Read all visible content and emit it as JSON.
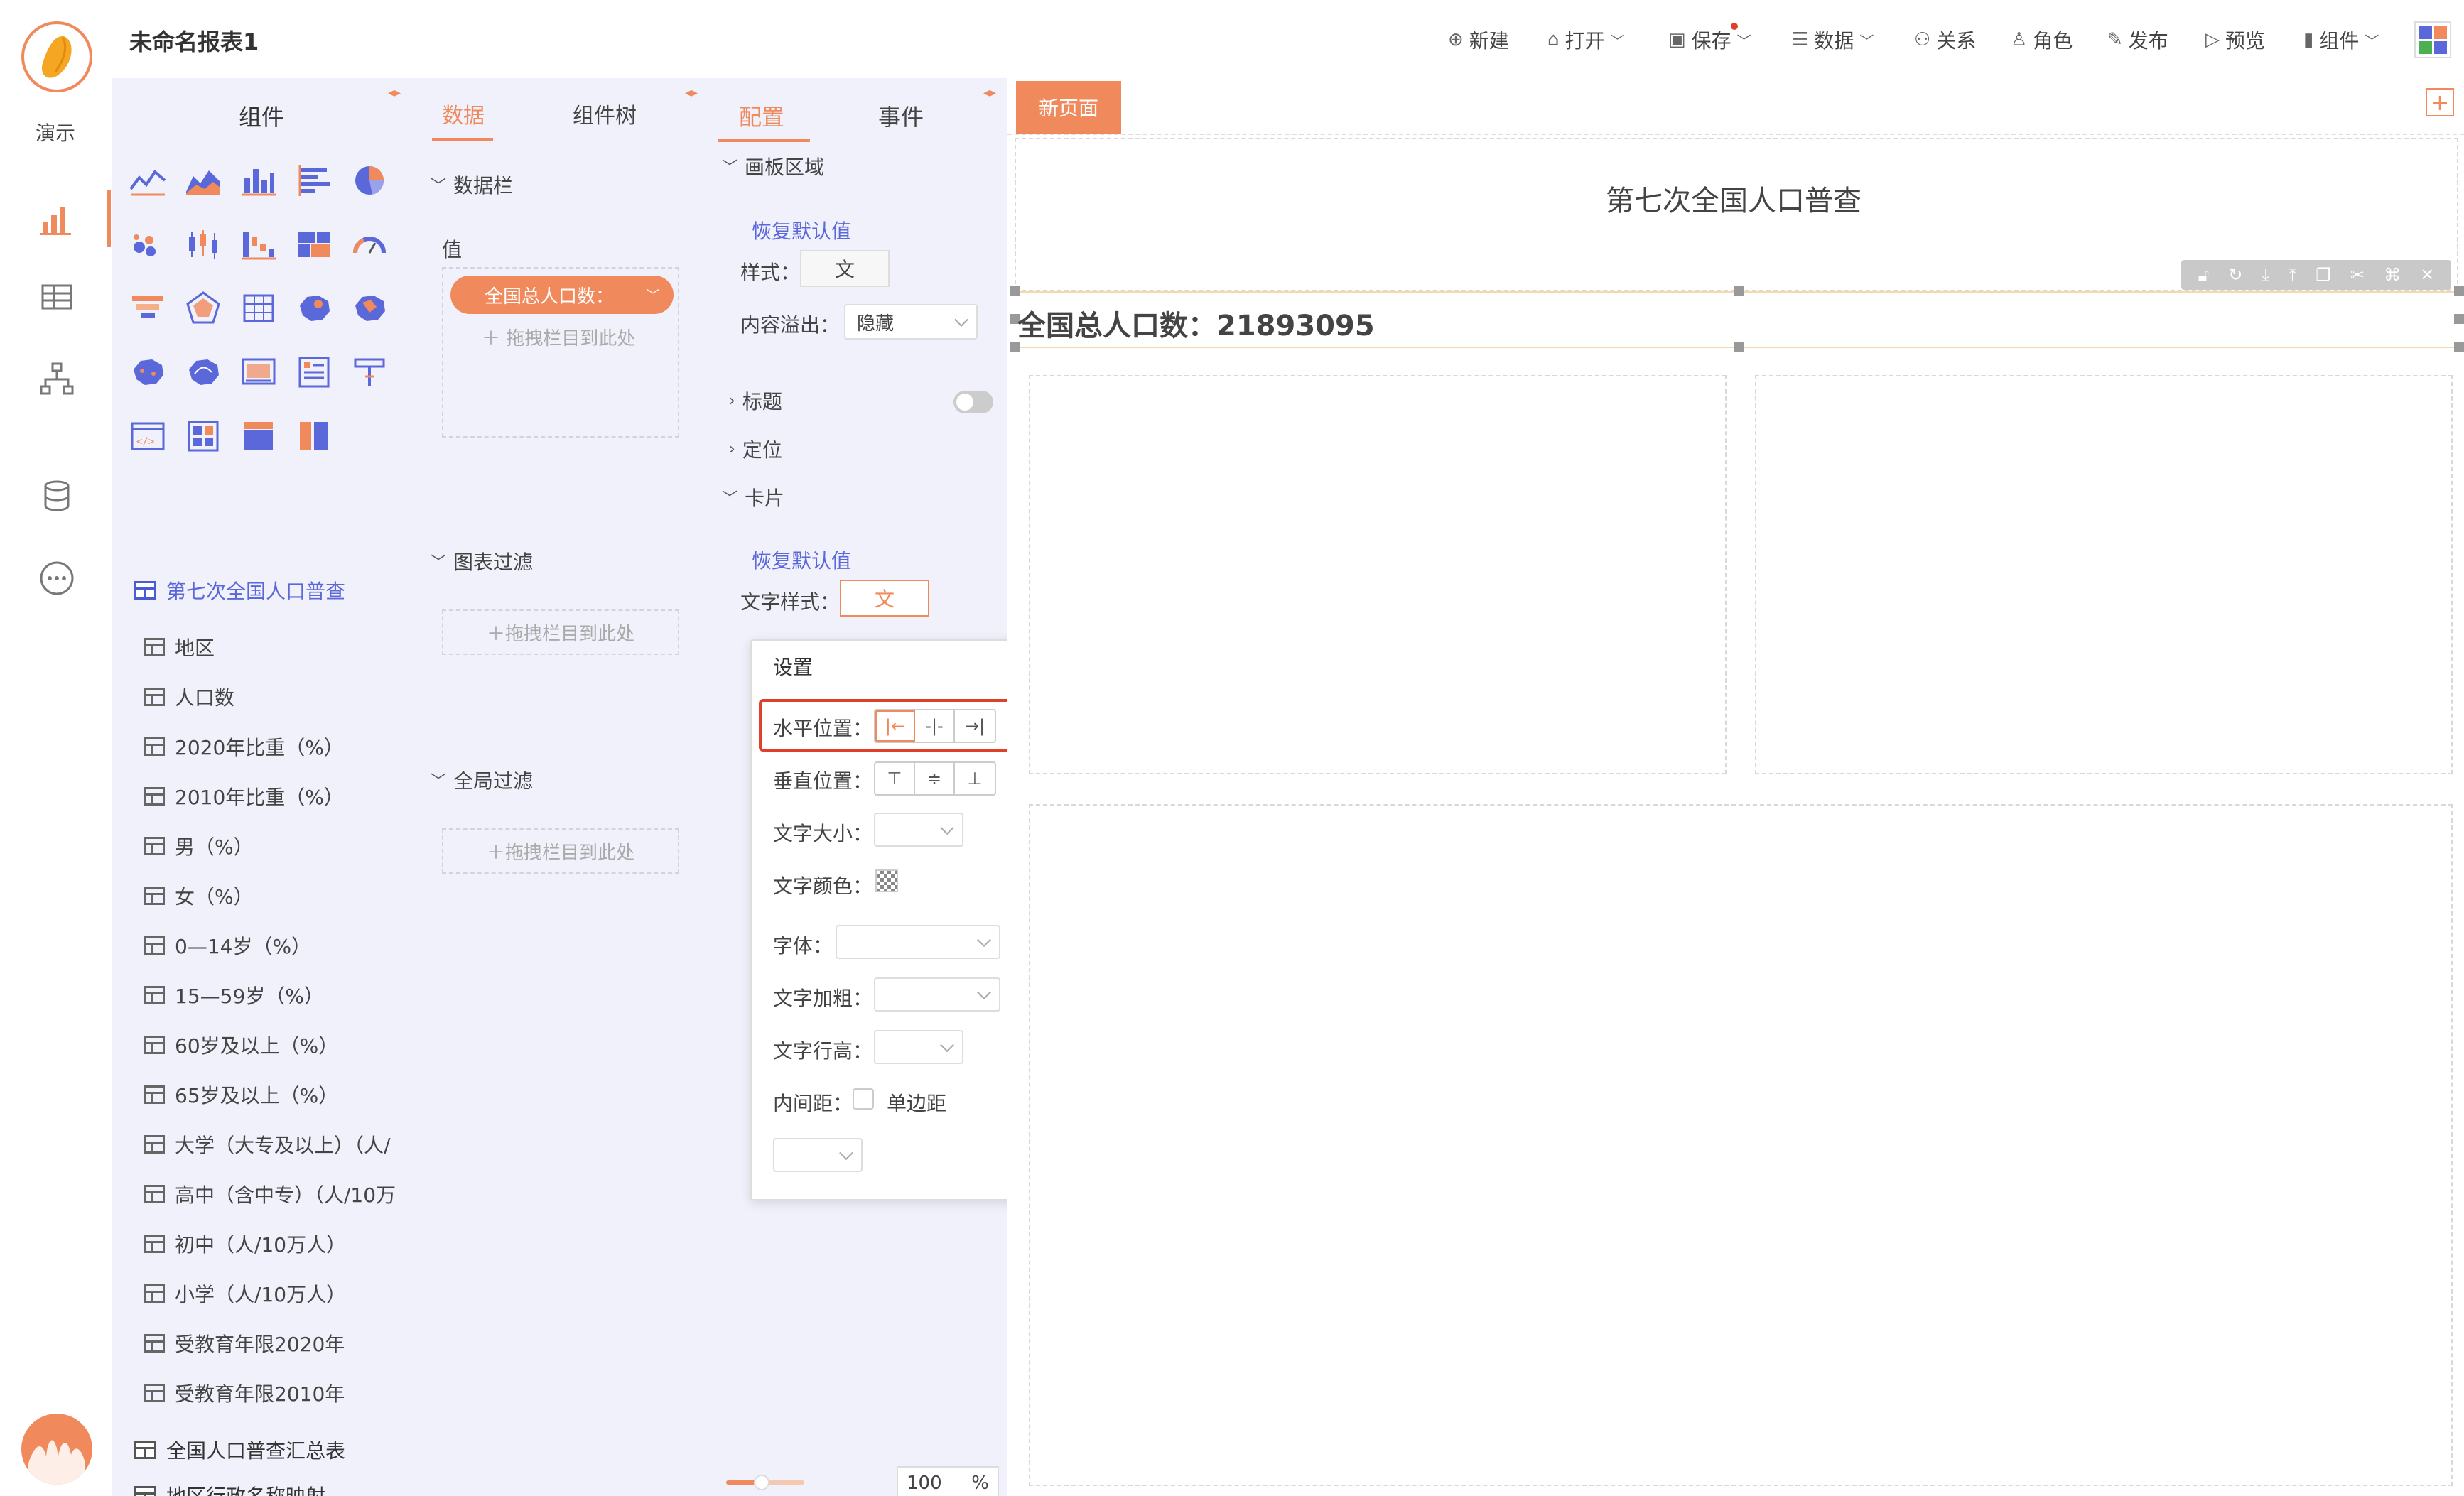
{
  "app": {
    "name": "演示",
    "report_title": "未命名报表1"
  },
  "toolbar": {
    "new": "新建",
    "open": "打开",
    "save": "保存",
    "data": "数据",
    "relations": "关系",
    "roles": "角色",
    "publish": "发布",
    "preview": "预览",
    "components": "组件"
  },
  "components_panel": {
    "title": "组件",
    "dataset": "第七次全国人口普查",
    "fields": [
      "地区",
      "人口数",
      "2020年比重（%）",
      "2010年比重（%）",
      "男（%）",
      "女（%）",
      "0—14岁（%）",
      "15—59岁（%）",
      "60岁及以上（%）",
      "65岁及以上（%）",
      "大学（大专及以上）（人/",
      "高中（含中专）（人/10万",
      "初中（人/10万人）",
      "小学（人/10万人）",
      "受教育年限2020年",
      "受教育年限2010年"
    ],
    "tables": [
      "全国人口普查汇总表",
      "地区行政名称映射"
    ]
  },
  "data_panel": {
    "tab_data": "数据",
    "tab_tree": "组件树",
    "section_data_bar": "数据栏",
    "value_label": "值",
    "value_pill": "全国总人口数：",
    "drop_hint": "拖拽栏目到此处",
    "section_chart_filter": "图表过滤",
    "section_global_filter": "全局过滤"
  },
  "config_panel": {
    "tab_config": "配置",
    "tab_events": "事件",
    "section_canvas": "画板区域",
    "restore_default": "恢复默认值",
    "style_label": "样式：",
    "style_value": "文",
    "overflow_label": "内容溢出：",
    "overflow_value": "隐藏",
    "section_title": "标题",
    "section_position": "定位",
    "section_card": "卡片",
    "text_style_label": "文字样式：",
    "text_style_value": "文",
    "zoom_value": "100",
    "zoom_unit": "%",
    "zoom_level": 0.45
  },
  "popup": {
    "title": "设置",
    "h_align": "水平位置：",
    "v_align": "垂直位置：",
    "font_size": "文字大小：",
    "font_color": "文字颜色：",
    "font_family": "字体：",
    "font_weight": "文字加粗：",
    "line_height": "文字行高：",
    "padding": "内间距：",
    "single_side": "单边距"
  },
  "canvas": {
    "tab": "新页面",
    "report_heading": "第七次全国人口普查",
    "kpi_text": "全国总人口数：21893095"
  },
  "colors": {
    "accent": "#f08a5d",
    "brand_blue": "#5b68d9",
    "highlight_red": "#e0402a"
  }
}
